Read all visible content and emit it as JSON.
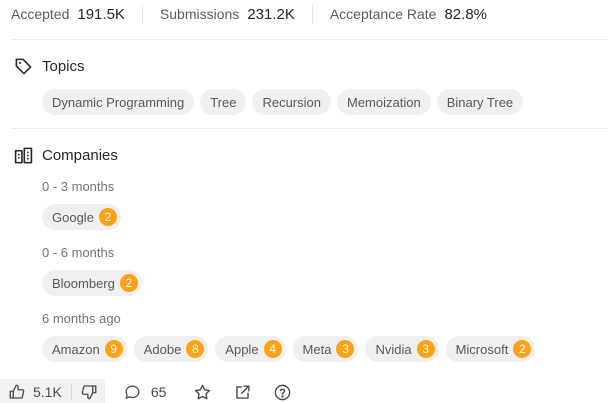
{
  "stats": {
    "accepted_label": "Accepted",
    "accepted_value": "191.5K",
    "submissions_label": "Submissions",
    "submissions_value": "231.2K",
    "acceptance_label": "Acceptance Rate",
    "acceptance_value": "82.8%"
  },
  "topics": {
    "title": "Topics",
    "icon": "tag-icon",
    "items": [
      "Dynamic Programming",
      "Tree",
      "Recursion",
      "Memoization",
      "Binary Tree"
    ]
  },
  "companies": {
    "title": "Companies",
    "icon": "building-icon",
    "accent_color": "#ffa116",
    "groups": [
      {
        "period": "0 - 3 months",
        "items": [
          {
            "name": "Google",
            "count": "2"
          }
        ]
      },
      {
        "period": "0 - 6 months",
        "items": [
          {
            "name": "Bloomberg",
            "count": "2"
          }
        ]
      },
      {
        "period": "6 months ago",
        "items": [
          {
            "name": "Amazon",
            "count": "9"
          },
          {
            "name": "Adobe",
            "count": "8"
          },
          {
            "name": "Apple",
            "count": "4"
          },
          {
            "name": "Meta",
            "count": "3"
          },
          {
            "name": "Nvidia",
            "count": "3"
          },
          {
            "name": "Microsoft",
            "count": "2"
          }
        ]
      }
    ]
  },
  "footer": {
    "likes": "5.1K",
    "comments": "65",
    "icons": [
      "thumbs-up-icon",
      "thumbs-down-icon",
      "comment-icon",
      "star-icon",
      "share-icon",
      "help-icon"
    ]
  }
}
